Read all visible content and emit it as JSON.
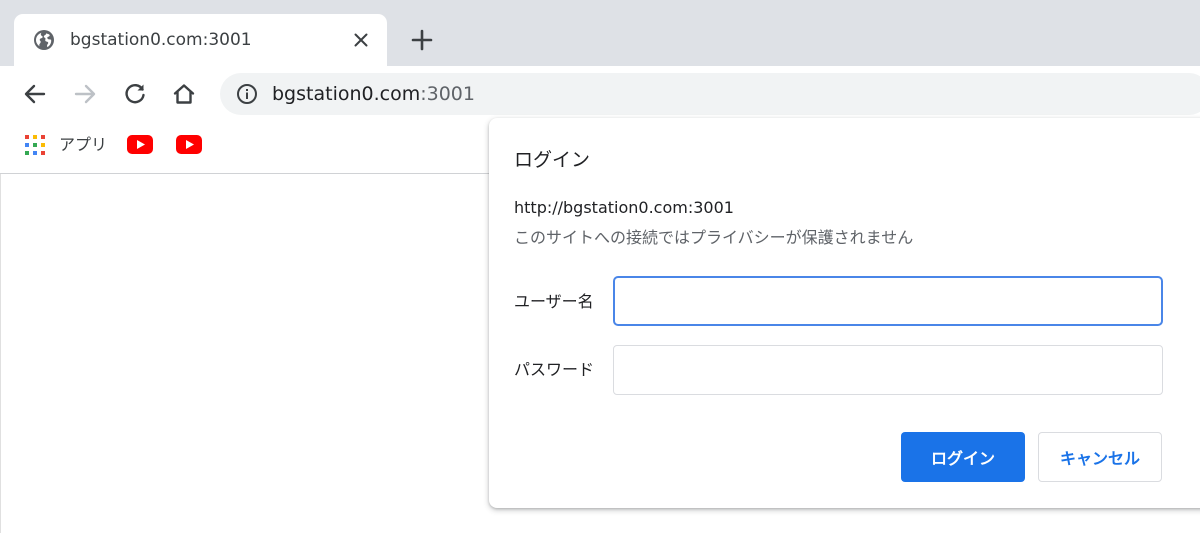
{
  "tab": {
    "title": "bgstation0.com:3001",
    "favicon_icon": "globe-icon",
    "close_icon": "close-icon"
  },
  "new_tab_icon": "plus-icon",
  "toolbar": {
    "back_icon": "arrow-back-icon",
    "forward_icon": "arrow-forward-icon",
    "reload_icon": "reload-icon",
    "home_icon": "home-icon",
    "info_icon": "info-icon",
    "url_host": "bgstation0.com",
    "url_port": ":3001"
  },
  "bookmarks": {
    "apps_label": "アプリ",
    "apps_icon": "apps-grid-icon",
    "items": [
      {
        "icon": "youtube-icon"
      },
      {
        "icon": "youtube-icon"
      }
    ]
  },
  "dialog": {
    "title": "ログイン",
    "origin": "http://bgstation0.com:3001",
    "warning": "このサイトへの接続ではプライバシーが保護されません",
    "username_label": "ユーザー名",
    "username_value": "",
    "password_label": "パスワード",
    "password_value": "",
    "login_button": "ログイン",
    "cancel_button": "キャンセル"
  },
  "colors": {
    "accent": "#1a73e8",
    "focus_ring": "#4a86e8",
    "tabstrip_bg": "#dee1e6",
    "omnibox_bg": "#f1f3f4",
    "youtube_red": "#ff0000"
  }
}
